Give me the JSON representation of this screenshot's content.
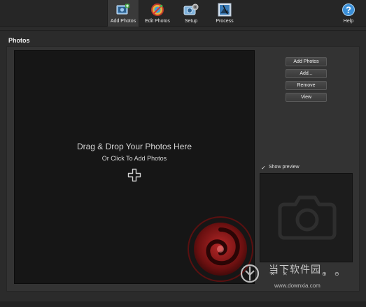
{
  "toolbar": {
    "items": [
      {
        "label": "Add Photos",
        "icon": "add-photos-icon",
        "active": true
      },
      {
        "label": "Edit Photos",
        "icon": "edit-photos-icon",
        "active": false
      },
      {
        "label": "Setup",
        "icon": "setup-icon",
        "active": false
      },
      {
        "label": "Process",
        "icon": "process-icon",
        "active": false
      }
    ],
    "help_label": "Help"
  },
  "section": {
    "title": "Photos"
  },
  "dropzone": {
    "main_text": "Drag & Drop Your Photos Here",
    "sub_text": "Or Click To Add Photos"
  },
  "buttons": {
    "add_photos": "Add Photos",
    "add": "Add...",
    "remove": "Remove",
    "view": "View"
  },
  "preview": {
    "checkbox_mark": "✓",
    "label": "Show preview",
    "checked": true
  },
  "watermark": {
    "cn_text": "当下软件园",
    "url": "www.downxia.com"
  },
  "colors": {
    "background": "#2b2b2b",
    "dropzone": "#161616",
    "swirl": "#b01a1a",
    "help_blue": "#3a8fd8"
  }
}
